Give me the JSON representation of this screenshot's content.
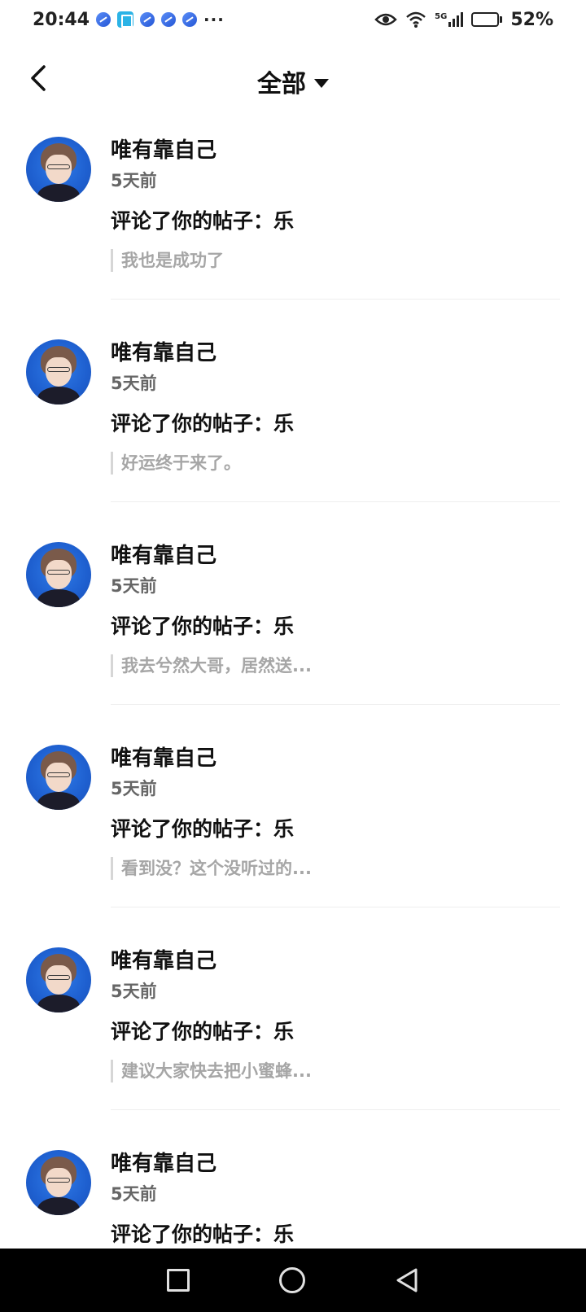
{
  "status_bar": {
    "time": "20:44",
    "more": "···",
    "network": "5G",
    "battery": "52%",
    "battery_level": 0.52
  },
  "header": {
    "title": "全部"
  },
  "notifications": [
    {
      "username": "唯有靠自己",
      "time": "5天前",
      "action": "评论了你的帖子：乐",
      "comment": "我也是成功了"
    },
    {
      "username": "唯有靠自己",
      "time": "5天前",
      "action": "评论了你的帖子：乐",
      "comment": "好运终于来了。"
    },
    {
      "username": "唯有靠自己",
      "time": "5天前",
      "action": "评论了你的帖子：乐",
      "comment": "我去兮然大哥，居然送..."
    },
    {
      "username": "唯有靠自己",
      "time": "5天前",
      "action": "评论了你的帖子：乐",
      "comment": "看到没？这个没听过的..."
    },
    {
      "username": "唯有靠自己",
      "time": "5天前",
      "action": "评论了你的帖子：乐",
      "comment": "建议大家快去把小蜜蜂..."
    },
    {
      "username": "唯有靠自己",
      "time": "5天前",
      "action": "评论了你的帖子：乐",
      "comment": ""
    }
  ]
}
